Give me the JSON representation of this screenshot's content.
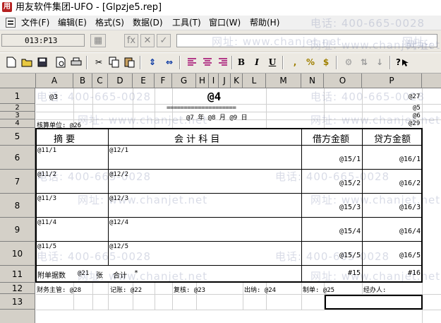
{
  "window": {
    "app_icon": "用",
    "title": "用友软件集团-UFO - [Glpzje5.rep]"
  },
  "menu": [
    "文件(F)",
    "编辑(E)",
    "格式(S)",
    "数据(D)",
    "工具(T)",
    "窗口(W)",
    "帮助(H)"
  ],
  "formula_bar": {
    "cell_ref": "013:P13",
    "fx_label": "fx",
    "cancel_label": "✕",
    "confirm_label": "✓"
  },
  "toolbar": {
    "bold": "B",
    "italic": "I",
    "underline": "U",
    "comma": ",",
    "percent": "%",
    "currency": "$",
    "help": "?"
  },
  "columns": [
    "A",
    "B",
    "C",
    "D",
    "E",
    "F",
    "G",
    "H",
    "I",
    "J",
    "K",
    "L",
    "M",
    "N",
    "O",
    "P"
  ],
  "rows": [
    "1",
    "2",
    "3",
    "4",
    "5",
    "6",
    "7",
    "8",
    "9",
    "10",
    "11",
    "12",
    "13"
  ],
  "watermark": {
    "phone": "电话: 400-665-0028",
    "web": "网址: www.chanjet.net",
    "phone_short": "电话:",
    "web_short": "网址:",
    "phone_partial": "电话: 400-665-0028",
    "web_partial": "网址: www.chanjet.net"
  },
  "cells": {
    "a1": "@3",
    "title": "@4",
    "p1": "@27",
    "rule": "====================",
    "p2": "@5",
    "date": "@7 年 @8 月 @9 日",
    "p3": "@6",
    "unit": "核算单位: @26",
    "p4": "@29",
    "h_summary": "摘    要",
    "h_account": "会 计 科 目",
    "h_debit": "借方金额",
    "h_credit": "贷方金额",
    "r6a": "@11/1",
    "r6d": "@12/1",
    "r6n": "@15/1",
    "r6p": "@16/1",
    "r7a": "@11/2",
    "r7d": "@12/2",
    "r7n": "@15/2",
    "r7p": "@16/2",
    "r8a": "@11/3",
    "r8d": "@12/3",
    "r8n": "@15/3",
    "r8p": "@16/3",
    "r9a": "@11/4",
    "r9d": "@12/4",
    "r9n": "@15/4",
    "r9p": "@16/4",
    "r10a": "@11/5",
    "r10d": "@12/5",
    "r10n": "@15/5",
    "r10p": "@16/5",
    "r11a": "附单据数",
    "r11b": "@21",
    "r11c": "张",
    "r11d": "合计",
    "r11e": "*",
    "r11n": "#15",
    "r11p": "#16",
    "r12a": "财务主管: @28",
    "r12d": "记账: @22",
    "r12g": "复核: @23",
    "r12l": "出纳: @24",
    "r12n": "制单: @25",
    "r12o": "经办人:"
  },
  "colors": {
    "chrome": "#d4d0c8",
    "watermark": "#8890b0"
  }
}
